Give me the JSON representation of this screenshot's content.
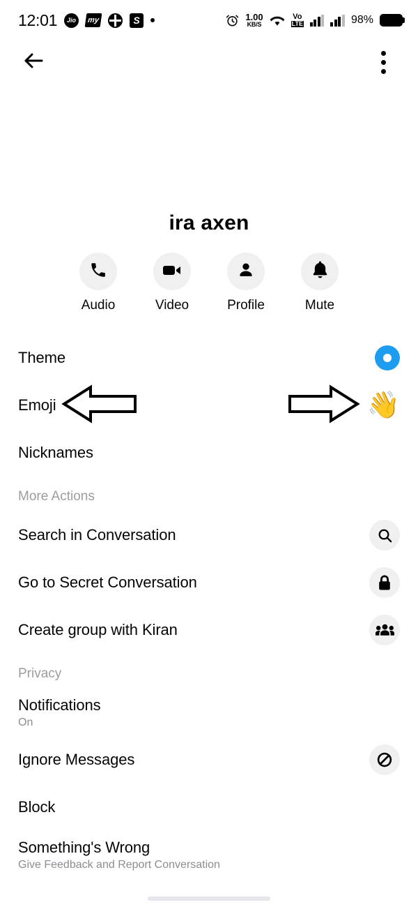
{
  "status_bar": {
    "time": "12:01",
    "left_icons": [
      "jio-icon",
      "myjio-icon",
      "circle-plus-icon",
      "s-app-icon",
      "dot-icon"
    ],
    "net_speed_value": "1.00",
    "net_speed_unit": "KB/S",
    "wifi_icon": "wifi-icon",
    "volte_top": "Vo",
    "volte_bottom": "LTE",
    "signal_icons": [
      "signal-bars-sim1",
      "signal-bars-sim2"
    ],
    "battery_percent": "98%",
    "alarm_icon": "alarm-icon"
  },
  "nav": {
    "back_icon": "back-arrow-icon",
    "overflow_icon": "kebab-menu-icon"
  },
  "profile": {
    "name": "ira   axen",
    "avatar_alt": "contact-avatar"
  },
  "quick_actions": [
    {
      "label": "Audio",
      "icon": "phone-icon"
    },
    {
      "label": "Video",
      "icon": "video-camera-icon"
    },
    {
      "label": "Profile",
      "icon": "person-icon"
    },
    {
      "label": "Mute",
      "icon": "bell-icon"
    }
  ],
  "settings": {
    "theme": {
      "label": "Theme",
      "indicator": "blue-circle-swatch",
      "accent_color": "#1e9cf0"
    },
    "emoji": {
      "label": "Emoji",
      "value_emoji": "👋"
    },
    "nicknames": {
      "label": "Nicknames"
    }
  },
  "annotations": {
    "left_arrow": "left-pointing-arrow",
    "right_arrow": "right-pointing-arrow"
  },
  "more_actions": {
    "header": "More Actions",
    "items": [
      {
        "label": "Search in Conversation",
        "icon": "search-icon"
      },
      {
        "label": "Go to Secret Conversation",
        "icon": "lock-icon"
      },
      {
        "label": "Create group with Kiran",
        "icon": "group-people-icon"
      }
    ]
  },
  "privacy": {
    "header": "Privacy",
    "items": [
      {
        "label": "Notifications",
        "sub": "On",
        "icon": null
      },
      {
        "label": "Ignore Messages",
        "sub": null,
        "icon": "ignore-slash-icon"
      },
      {
        "label": "Block",
        "sub": null,
        "icon": null
      },
      {
        "label": "Something's Wrong",
        "sub": "Give Feedback and Report Conversation",
        "icon": null
      }
    ]
  },
  "colors": {
    "accent": "#1e9cf0",
    "icon_bg": "#f0f0f0",
    "text": "#050505",
    "muted": "#8a8d91",
    "section_head": "#9b9da1"
  }
}
